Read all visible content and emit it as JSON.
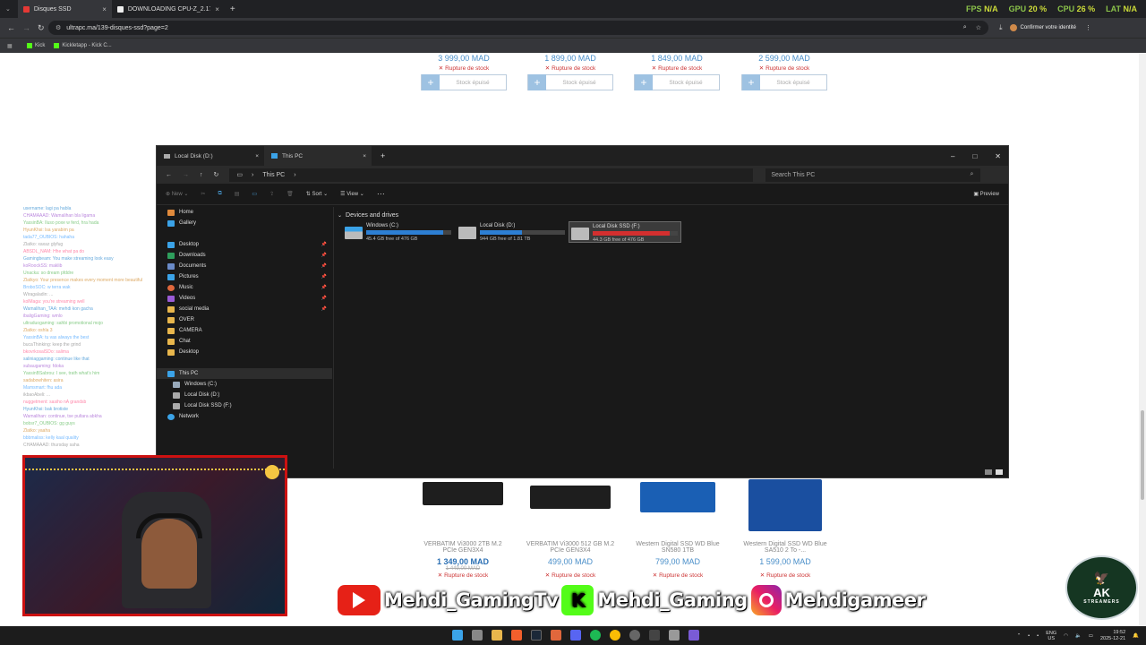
{
  "browser": {
    "tabs": [
      {
        "title": "Disques SSD",
        "active": true
      },
      {
        "title": "DOWNLOADING CPU-Z_2.17-E",
        "active": false
      }
    ],
    "url": "ultrapc.ma/139-disques-ssd?page=2",
    "identity_button": "Confirmer votre identité",
    "bookmarks": [
      "Kick",
      "Kickletapp - Kick C..."
    ]
  },
  "overlay_stats": {
    "fps_label": "FPS",
    "fps_value": "N/A",
    "gpu_label": "GPU",
    "gpu_value": "20 %",
    "cpu_label": "CPU",
    "cpu_value": "26 %",
    "lat_label": "LAT",
    "lat_value": "N/A"
  },
  "webpage": {
    "top_products": [
      {
        "price": "3 999,00 MAD",
        "status": "Rupture de stock",
        "button": "Stock épuisé"
      },
      {
        "price": "1 899,00 MAD",
        "status": "Rupture de stock",
        "button": "Stock épuisé"
      },
      {
        "price": "1 849,00 MAD",
        "status": "Rupture de stock",
        "button": "Stock épuisé"
      },
      {
        "price": "2 599,00 MAD",
        "status": "Rupture de stock",
        "button": "Stock épuisé"
      }
    ],
    "bottom_products": [
      {
        "name": "VERBATIM Vi3000 2TB M.2 PCIe GEN3X4",
        "price": "1 349,00 MAD",
        "old_price": "1 449,00 MAD",
        "status": "Rupture de stock"
      },
      {
        "name": "VERBATIM Vi3000 512 GB M.2 PCIe GEN3X4",
        "price": "499,00 MAD",
        "status": "Rupture de stock"
      },
      {
        "name": "Western Digital SSD WD Blue SN580 1TB",
        "price": "799,00 MAD",
        "status": "Rupture de stock"
      },
      {
        "name": "Western Digital SSD WD Blue SA510 2 To -...",
        "price": "1 599,00 MAD",
        "status": "Rupture de stock"
      }
    ]
  },
  "explorer": {
    "tabs": [
      {
        "title": "Local Disk (D:)"
      },
      {
        "title": "This PC"
      }
    ],
    "breadcrumb": "This PC",
    "search_placeholder": "Search This PC",
    "toolbar": {
      "new": "New",
      "sort": "Sort",
      "view": "View",
      "preview": "Preview"
    },
    "sidebar": {
      "top": [
        "Home",
        "Gallery"
      ],
      "pinned": [
        "Desktop",
        "Downloads",
        "Documents",
        "Pictures",
        "Music",
        "Videos",
        "social media"
      ],
      "folders": [
        "OVER",
        "CAMERA",
        "Chat",
        "Desktop"
      ],
      "this_pc": "This PC",
      "drives": [
        "Windows (C:)",
        "Local Disk (D:)",
        "Local Disk SSD (F:)"
      ],
      "network": "Network"
    },
    "section_title": "Devices and drives",
    "drives": [
      {
        "name": "Windows (C:)",
        "free": "45.4 GB free of 476 GB",
        "used_fraction": 0.905,
        "color": "#2d7fd3"
      },
      {
        "name": "Local Disk (D:)",
        "free": "944 GB free of 1.81 TB",
        "used_fraction": 0.49,
        "color": "#2d7fd3"
      },
      {
        "name": "Local Disk SSD (F:)",
        "free": "44.3 GB free of 476 GB",
        "used_fraction": 0.907,
        "color": "#d32f2f",
        "selected": true
      }
    ]
  },
  "chat": {
    "lines": [
      "username: lagi pa habla",
      "CHAMAAAD: Wamalihan bla ligama",
      "YassinBA: Iluso poxe w ferd, hra hada",
      "HyunKhsi: lsa yarabim pa",
      "tada77_OUBIOS: hahaha",
      "Zlatko: xaxaz glyfug",
      "ABSDL_NAM: Hhe what pa do",
      "Gamingbeam: You make streaming look easy",
      "koRoockSS: maklib",
      "Unacka: so dream pfddre",
      "Zlatkyo: Your presence makes every moment more beautiful",
      "BroboSOC: w terra wak",
      "Wiragaladin: ...",
      "kolMaga: you're streaming well",
      "Wamalihan_TAA: mehdi kon gacha",
      "ibaligGaming: wmlo",
      "ultraduogaming: sahbi promotional mojo",
      "Zlatko: oshla 3",
      "YassinBA: tu vas always the best",
      "bucaThinking: keep the grind",
      "bkovrkosalSDo: salima",
      "saliniaggaming: continue like that",
      "subaugaming: fdoka",
      "YassinBSabrou: I see, trath what's him",
      "sadabowhiten: asira",
      "Mamsmart: fhu ada",
      "ikbaoAbeli: ...",
      "nuggetment: sasiho nA grandsb",
      "HyunKhsi: bak brotiste",
      "Wamalihan: continue, tse pultara abkha",
      "bobsr7_OUBIOS: gg guys",
      "Zlatko: yaaha",
      "bbbmaliss: kelly kaal quality",
      "CHAMAAAD: thursday saha"
    ]
  },
  "socials": {
    "youtube": "Mehdi_GamingTv",
    "kick": "Mehdi_Gaming",
    "instagram": "Mehdigameer"
  },
  "logo": {
    "text": "AK",
    "subtext": "STREAMERS"
  },
  "taskbar": {
    "lang": "ENG",
    "region": "US",
    "time": "19:52",
    "date": "2025-12-21"
  }
}
